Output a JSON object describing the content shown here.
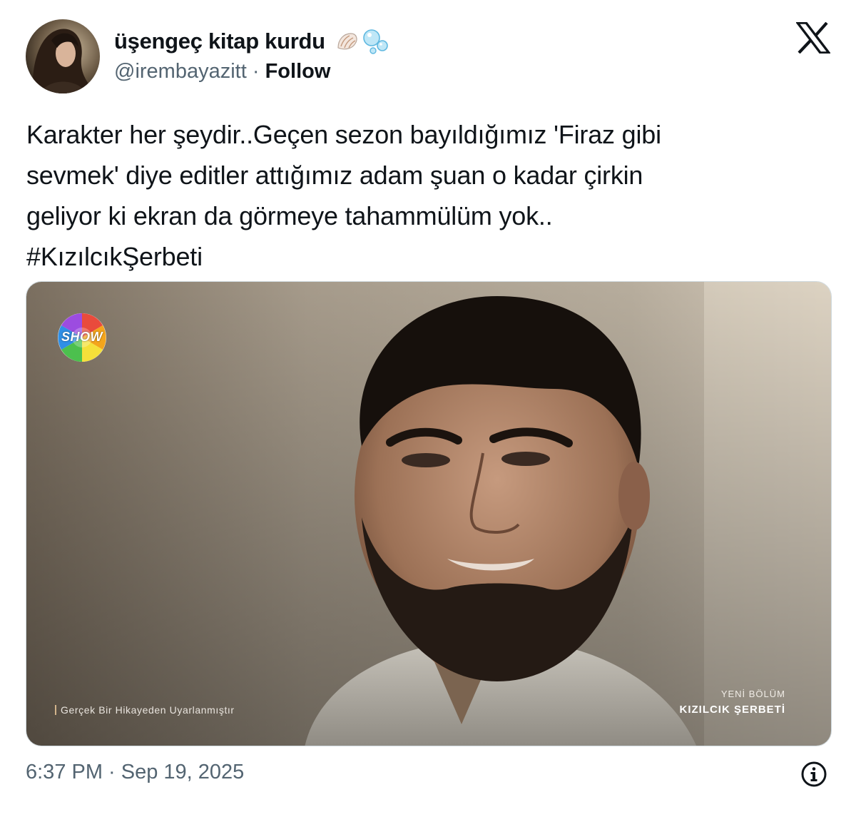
{
  "author": {
    "display_name": "üşengeç kitap kurdu",
    "handle": "@irembayazitt",
    "separator": "·",
    "follow_label": "Follow",
    "name_emojis": [
      "shell-emoji",
      "bubbles-emoji"
    ]
  },
  "logo": {
    "icon": "x-logo-icon"
  },
  "tweet": {
    "lines": [
      "Karakter her şeydir..Geçen sezon bayıldığımız 'Firaz gibi",
      "sevmek' diye editler attığımız adam şuan o kadar çirkin",
      "geliyor ki ekran da görmeye tahammülüm yok.."
    ],
    "hashtag": "#KızılcıkŞerbeti"
  },
  "media": {
    "channel_logo_text": "SHOW",
    "caption_left": "Gerçek Bir Hikayeden Uyarlanmıştır",
    "caption_right_top": "YENİ BÖLÜM",
    "caption_right_bottom": "KIZILCIK ŞERBETİ"
  },
  "footer": {
    "timestamp": "6:37 PM · Sep 19, 2025",
    "info_icon": "info-icon"
  },
  "colors": {
    "text_primary": "#0f1419",
    "text_secondary": "#536471",
    "border": "#cfd9de"
  }
}
